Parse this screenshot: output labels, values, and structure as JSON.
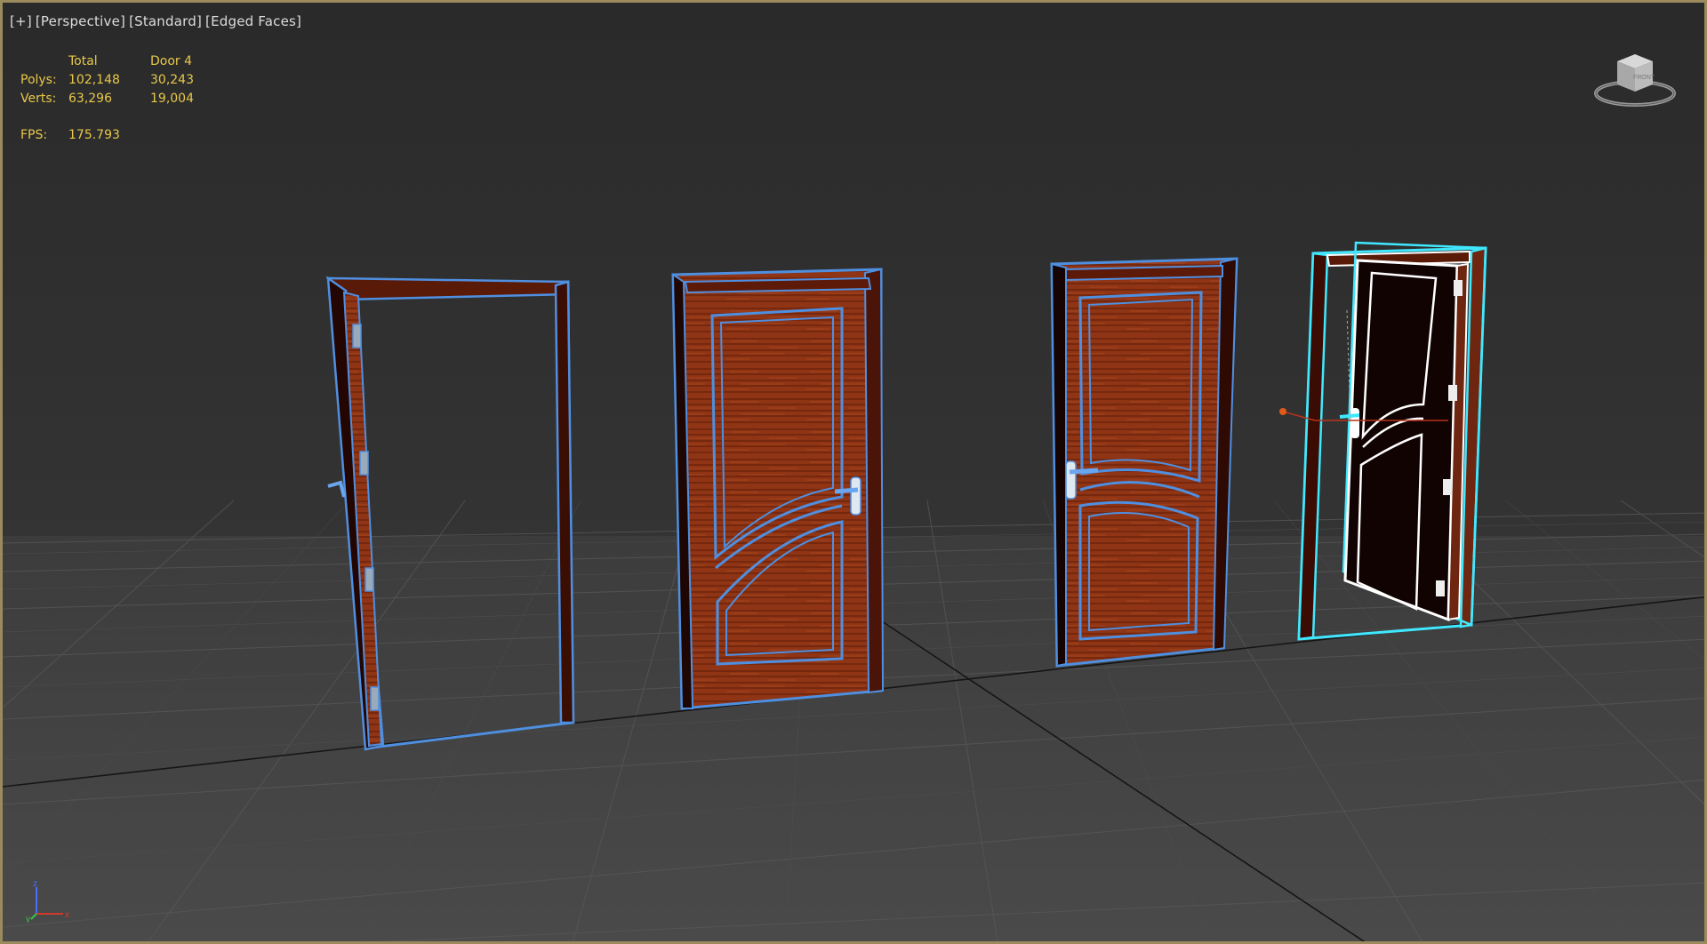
{
  "viewport": {
    "labels": [
      "[+]",
      "[Perspective]",
      "[Standard]",
      "[Edged Faces]"
    ]
  },
  "stats": {
    "col_total": "Total",
    "col_selected": "Door 4",
    "polys_label": "Polys:",
    "polys_total": "102,148",
    "polys_selected": "30,243",
    "verts_label": "Verts:",
    "verts_total": "63,296",
    "verts_selected": "19,004",
    "fps_label": "FPS:",
    "fps_value": "175.793"
  },
  "viewcube": {
    "face_label": "FRONT"
  },
  "axis": {
    "z": "z",
    "x": "x",
    "y": "y"
  },
  "colors": {
    "background": "#2c2c2c",
    "viewport_border": "#9a8a5c",
    "stats_text": "#e8c84a",
    "wood": "#8a2e12",
    "edge_blue": "#4f8fe0",
    "selection_cyan": "#40e8ff"
  }
}
